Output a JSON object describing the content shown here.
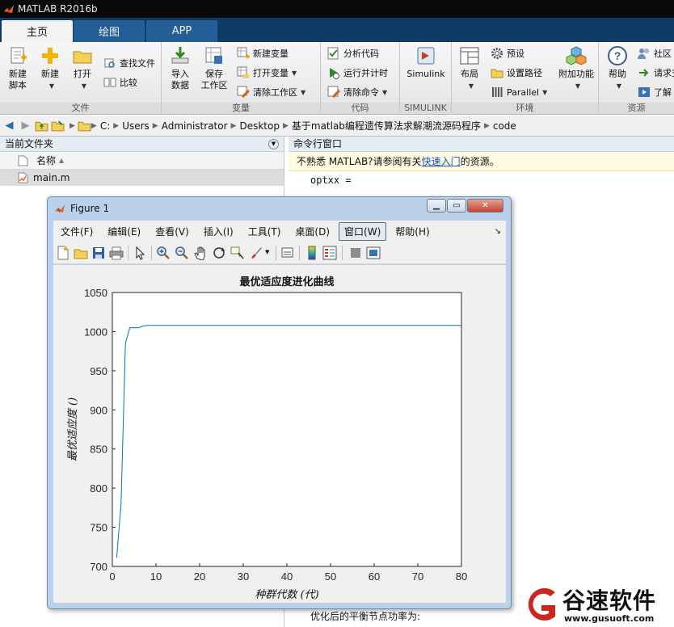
{
  "app": {
    "title": "MATLAB R2016b",
    "tabs": [
      {
        "label": "主页"
      },
      {
        "label": "绘图"
      },
      {
        "label": "APP"
      }
    ]
  },
  "ribbon": {
    "file": {
      "label": "文件",
      "new_script": "新建\n脚本",
      "new": "新建",
      "open": "打开",
      "find_files": "查找文件",
      "compare": "比较"
    },
    "variable": {
      "label": "变量",
      "import": "导入\n数据",
      "save_workspace": "保存\n工作区",
      "new_variable": "新建变量",
      "open_variable": "打开变量",
      "clear_workspace": "清除工作区"
    },
    "code": {
      "label": "代码",
      "analyze": "分析代码",
      "run_time": "运行并计时",
      "clear_commands": "清除命令"
    },
    "simulink": {
      "label": "SIMULINK",
      "button": "Simulink"
    },
    "environment": {
      "label": "环境",
      "layout": "布局",
      "preferences": "预设",
      "set_path": "设置路径",
      "parallel": "Parallel",
      "addons": "附加功能"
    },
    "resources": {
      "label": "资源",
      "help": "帮助",
      "community": "社区",
      "request_support": "请求支",
      "learn": "了解"
    }
  },
  "address": {
    "crumbs": [
      "C:",
      "Users",
      "Administrator",
      "Desktop",
      "基于matlab编程遗传算法求解潮流源码程序",
      "code"
    ]
  },
  "current_folder": {
    "title": "当前文件夹",
    "column_name": "名称",
    "files": [
      {
        "name": "main.m"
      }
    ]
  },
  "command_window": {
    "title": "命令行窗口",
    "notice_before": "不熟悉 MATLAB?请参阅有关",
    "notice_link": "快速入门",
    "notice_after": "的资源。",
    "line_optxx": "optxx =",
    "line_bottom": "优化后的平衡节点功率为:"
  },
  "figure": {
    "title": "Figure 1",
    "menu": [
      "文件(F)",
      "编辑(E)",
      "查看(V)",
      "插入(I)",
      "工具(T)",
      "桌面(D)",
      "窗口(W)",
      "帮助(H)"
    ],
    "selected_menu_index": 6
  },
  "chart_data": {
    "type": "line",
    "title": "最优适应度进化曲线",
    "xlabel": "种群代数 (代)",
    "ylabel": "最优适应度 ()",
    "xlim": [
      0,
      80
    ],
    "ylim": [
      700,
      1050
    ],
    "xticks": [
      0,
      10,
      20,
      30,
      40,
      50,
      60,
      70,
      80
    ],
    "yticks": [
      700,
      750,
      800,
      850,
      900,
      950,
      1000,
      1050
    ],
    "grid": false,
    "line_color": "#0072bd",
    "x": [
      1,
      2,
      3,
      4,
      5,
      6,
      7,
      8,
      9,
      10,
      20,
      30,
      40,
      50,
      60,
      70,
      80
    ],
    "y": [
      711,
      780,
      985,
      1005,
      1005,
      1005,
      1007,
      1008,
      1008,
      1008,
      1008,
      1008,
      1008,
      1008,
      1008,
      1008,
      1008
    ]
  },
  "watermark": {
    "brand": "谷速软件",
    "url": "www.gusuoft.com"
  }
}
